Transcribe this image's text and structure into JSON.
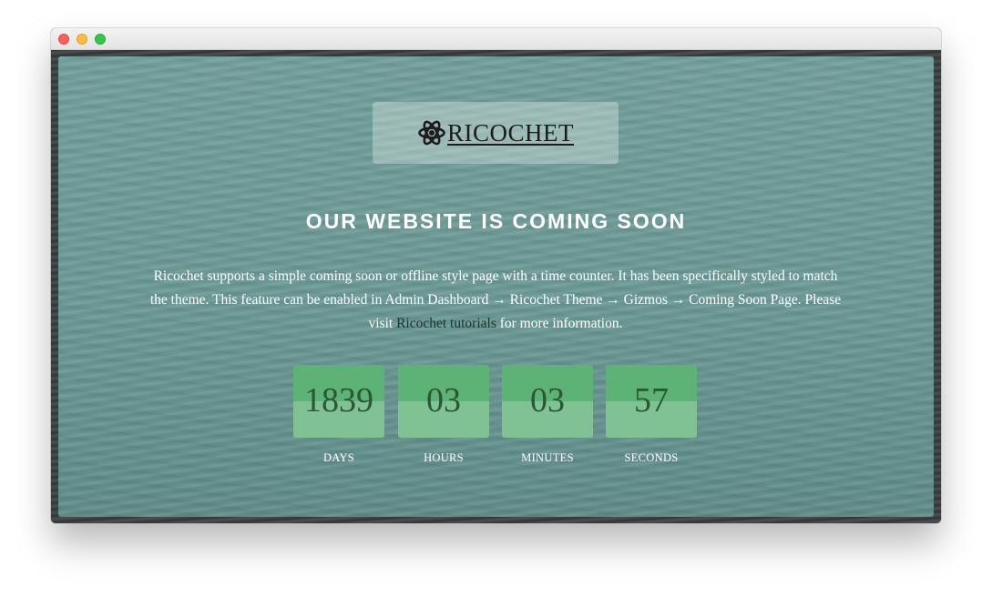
{
  "browser": {
    "controls": [
      "close",
      "minimize",
      "zoom"
    ]
  },
  "logo": {
    "text": "RICOCHET",
    "icon": "atom-icon"
  },
  "headline": "OUR WEBSITE IS COMING SOON",
  "description": {
    "before_link": "Ricochet supports a simple coming soon or offline style page with a time counter. It has been specifically styled to match the theme. This feature can be enabled in Admin Dashboard → Ricochet Theme → Gizmos → Coming Soon Page. Please visit ",
    "link_text": "Ricochet tutorials",
    "after_link": " for more information."
  },
  "countdown": [
    {
      "value": "1839",
      "label": "DAYS"
    },
    {
      "value": "03",
      "label": "HOURS"
    },
    {
      "value": "03",
      "label": "MINUTES"
    },
    {
      "value": "57",
      "label": "SECONDS"
    }
  ],
  "colors": {
    "tile_top": "#5db375",
    "tile_bottom": "#80c294",
    "digit": "#2a5736",
    "overlay": "#6d9c98"
  }
}
